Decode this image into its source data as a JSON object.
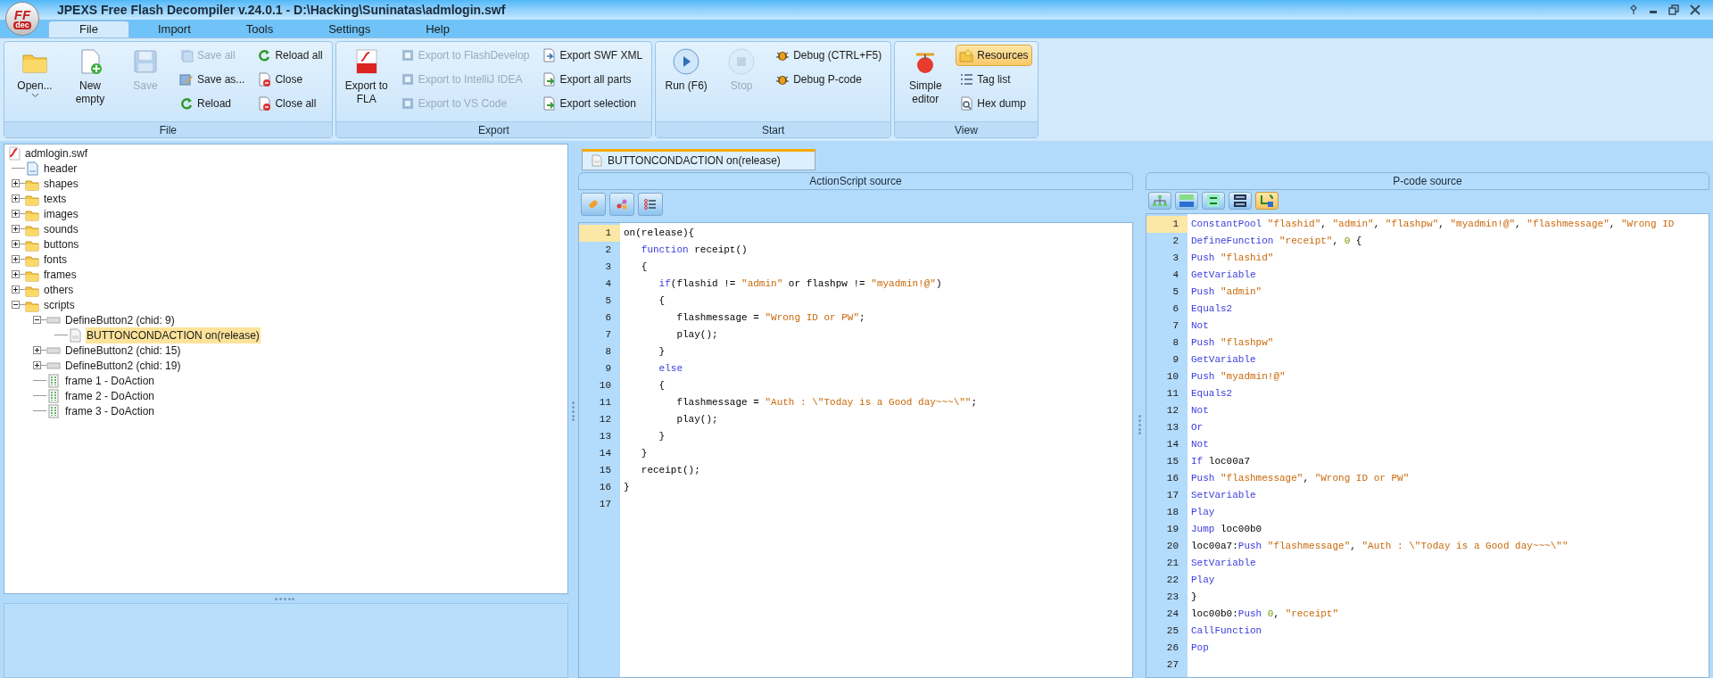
{
  "window": {
    "title": "JPEXS Free Flash Decompiler v.24.0.1 - D:\\Hacking\\Suninatas\\admlogin.swf",
    "logo": {
      "top": "FF",
      "bottom": "dec"
    }
  },
  "ribbon": {
    "tabs": [
      {
        "label": "File",
        "selected": true
      },
      {
        "label": "Import",
        "selected": false
      },
      {
        "label": "Tools",
        "selected": false
      },
      {
        "label": "Settings",
        "selected": false
      },
      {
        "label": "Help",
        "selected": false
      }
    ],
    "groups": [
      {
        "label": "File",
        "items": [
          {
            "kind": "large",
            "label": "Open...",
            "dropdown": true,
            "disabled": false
          },
          {
            "kind": "large",
            "label": "New empty",
            "disabled": false
          },
          {
            "kind": "large",
            "label": "Save",
            "disabled": true
          },
          {
            "kind": "column",
            "items": [
              {
                "label": "Save all",
                "disabled": true,
                "selected": false
              },
              {
                "label": "Save as...",
                "disabled": false,
                "selected": false
              },
              {
                "label": "Reload",
                "disabled": false,
                "selected": false
              }
            ]
          },
          {
            "kind": "column",
            "items": [
              {
                "label": "Reload all",
                "disabled": false,
                "selected": false
              },
              {
                "label": "Close",
                "disabled": false,
                "selected": false
              },
              {
                "label": "Close all",
                "disabled": false,
                "selected": false
              }
            ]
          }
        ]
      },
      {
        "label": "Export",
        "items": [
          {
            "kind": "large",
            "label": "Export to FLA",
            "disabled": false
          },
          {
            "kind": "column",
            "items": [
              {
                "label": "Export to FlashDevelop",
                "disabled": true,
                "selected": false
              },
              {
                "label": "Export to IntelliJ IDEA",
                "disabled": true,
                "selected": false
              },
              {
                "label": "Export to VS Code",
                "disabled": true,
                "selected": false
              }
            ]
          },
          {
            "kind": "column",
            "items": [
              {
                "label": "Export SWF XML",
                "disabled": false,
                "selected": false
              },
              {
                "label": "Export all parts",
                "disabled": false,
                "selected": false
              },
              {
                "label": "Export selection",
                "disabled": false,
                "selected": false
              }
            ]
          }
        ]
      },
      {
        "label": "Start",
        "items": [
          {
            "kind": "large",
            "label": "Run (F6)",
            "disabled": false
          },
          {
            "kind": "large",
            "label": "Stop",
            "disabled": true
          },
          {
            "kind": "column",
            "items": [
              {
                "label": "Debug (CTRL+F5)",
                "disabled": false,
                "selected": false
              },
              {
                "label": "Debug P-code",
                "disabled": false,
                "selected": false
              }
            ]
          }
        ]
      },
      {
        "label": "View",
        "items": [
          {
            "kind": "large",
            "label": "Simple editor",
            "disabled": false
          },
          {
            "kind": "column",
            "items": [
              {
                "label": "Resources",
                "disabled": false,
                "selected": true
              },
              {
                "label": "Tag list",
                "disabled": false,
                "selected": false
              },
              {
                "label": "Hex dump",
                "disabled": false,
                "selected": false
              }
            ]
          }
        ]
      }
    ]
  },
  "tree": [
    {
      "label": "admlogin.swf",
      "kind": "swf",
      "selected": false,
      "children": [
        {
          "label": "header",
          "kind": "header",
          "selected": false
        },
        {
          "label": "shapes",
          "kind": "folder",
          "selected": false,
          "expanded": false
        },
        {
          "label": "texts",
          "kind": "folder",
          "selected": false,
          "expanded": false
        },
        {
          "label": "images",
          "kind": "folder",
          "selected": false,
          "expanded": false
        },
        {
          "label": "sounds",
          "kind": "folder",
          "selected": false,
          "expanded": false
        },
        {
          "label": "buttons",
          "kind": "folder",
          "selected": false,
          "expanded": false
        },
        {
          "label": "fonts",
          "kind": "folder",
          "selected": false,
          "expanded": false
        },
        {
          "label": "frames",
          "kind": "folder",
          "selected": false,
          "expanded": false
        },
        {
          "label": "others",
          "kind": "folder",
          "selected": false,
          "expanded": false
        },
        {
          "label": "scripts",
          "kind": "folder",
          "selected": false,
          "expanded": true,
          "children": [
            {
              "label": "DefineButton2 (chid: 9)",
              "kind": "button",
              "selected": false,
              "expanded": true,
              "children": [
                {
                  "label": "BUTTONCONDACTION on(release)",
                  "kind": "script",
                  "selected": true
                }
              ]
            },
            {
              "label": "DefineButton2 (chid: 15)",
              "kind": "button",
              "selected": false,
              "expanded": false
            },
            {
              "label": "DefineButton2 (chid: 19)",
              "kind": "button",
              "selected": false,
              "expanded": false
            },
            {
              "label": "frame 1 - DoAction",
              "kind": "frame",
              "selected": false
            },
            {
              "label": "frame 2 - DoAction",
              "kind": "frame",
              "selected": false
            },
            {
              "label": "frame 3 - DoAction",
              "kind": "frame",
              "selected": false
            }
          ]
        }
      ]
    }
  ],
  "editor_tabs": [
    {
      "label": "BUTTONCONDACTION on(release)",
      "selected": true
    }
  ],
  "actionscript": {
    "title": "ActionScript source",
    "toolbar": [
      {
        "selected": false
      },
      {
        "selected": false
      },
      {
        "selected": false
      }
    ],
    "lines": [
      {
        "number": "1",
        "selected": true,
        "tokens": [
          {
            "kind": "plain",
            "text": "on(release){"
          }
        ]
      },
      {
        "number": "2",
        "selected": false,
        "tokens": [
          {
            "kind": "keyword",
            "text": "   function"
          },
          {
            "kind": "plain",
            "text": " receipt()"
          }
        ]
      },
      {
        "number": "3",
        "selected": false,
        "tokens": [
          {
            "kind": "plain",
            "text": "   {"
          }
        ]
      },
      {
        "number": "4",
        "selected": false,
        "tokens": [
          {
            "kind": "keyword",
            "text": "      if"
          },
          {
            "kind": "plain",
            "text": "(flashid != "
          },
          {
            "kind": "string",
            "text": "\"admin\""
          },
          {
            "kind": "plain",
            "text": " or flashpw != "
          },
          {
            "kind": "string",
            "text": "\"myadmin!@\""
          },
          {
            "kind": "plain",
            "text": ")"
          }
        ]
      },
      {
        "number": "5",
        "selected": false,
        "tokens": [
          {
            "kind": "plain",
            "text": "      {"
          }
        ]
      },
      {
        "number": "6",
        "selected": false,
        "tokens": [
          {
            "kind": "plain",
            "text": "         flashmessage = "
          },
          {
            "kind": "string",
            "text": "\"Wrong ID or PW\""
          },
          {
            "kind": "plain",
            "text": ";"
          }
        ]
      },
      {
        "number": "7",
        "selected": false,
        "tokens": [
          {
            "kind": "plain",
            "text": "         play();"
          }
        ]
      },
      {
        "number": "8",
        "selected": false,
        "tokens": [
          {
            "kind": "plain",
            "text": "      }"
          }
        ]
      },
      {
        "number": "9",
        "selected": false,
        "tokens": [
          {
            "kind": "keyword",
            "text": "      else"
          }
        ]
      },
      {
        "number": "10",
        "selected": false,
        "tokens": [
          {
            "kind": "plain",
            "text": "      {"
          }
        ]
      },
      {
        "number": "11",
        "selected": false,
        "tokens": [
          {
            "kind": "plain",
            "text": "         flashmessage = "
          },
          {
            "kind": "string",
            "text": "\"Auth : \\\"Today is a Good day~~~\\\"\""
          },
          {
            "kind": "plain",
            "text": ";"
          }
        ]
      },
      {
        "number": "12",
        "selected": false,
        "tokens": [
          {
            "kind": "plain",
            "text": "         play();"
          }
        ]
      },
      {
        "number": "13",
        "selected": false,
        "tokens": [
          {
            "kind": "plain",
            "text": "      }"
          }
        ]
      },
      {
        "number": "14",
        "selected": false,
        "tokens": [
          {
            "kind": "plain",
            "text": "   }"
          }
        ]
      },
      {
        "number": "15",
        "selected": false,
        "tokens": [
          {
            "kind": "plain",
            "text": "   receipt();"
          }
        ]
      },
      {
        "number": "16",
        "selected": false,
        "tokens": [
          {
            "kind": "plain",
            "text": "}"
          }
        ]
      },
      {
        "number": "17",
        "selected": false
      }
    ]
  },
  "pcode": {
    "title": "P-code source",
    "toolbar": [
      {
        "selected": false
      },
      {
        "selected": false
      },
      {
        "selected": false
      },
      {
        "selected": false
      },
      {
        "selected": true
      }
    ],
    "lines": [
      {
        "number": "1",
        "selected": true,
        "tokens": [
          {
            "kind": "keyword",
            "text": "ConstantPool"
          },
          {
            "kind": "string",
            "text": " \"flashid\""
          },
          {
            "kind": "plain",
            "text": ","
          },
          {
            "kind": "string",
            "text": " \"admin\""
          },
          {
            "kind": "plain",
            "text": ","
          },
          {
            "kind": "string",
            "text": " \"flashpw\""
          },
          {
            "kind": "plain",
            "text": ","
          },
          {
            "kind": "string",
            "text": " \"myadmin!@\""
          },
          {
            "kind": "plain",
            "text": ","
          },
          {
            "kind": "string",
            "text": " \"flashmessage\""
          },
          {
            "kind": "plain",
            "text": ","
          },
          {
            "kind": "string",
            "text": " \"Wrong ID"
          }
        ]
      },
      {
        "number": "2",
        "selected": false,
        "tokens": [
          {
            "kind": "keyword",
            "text": "DefineFunction"
          },
          {
            "kind": "string",
            "text": " \"receipt\""
          },
          {
            "kind": "plain",
            "text": ","
          },
          {
            "kind": "number",
            "text": " 0"
          },
          {
            "kind": "plain",
            "text": " {"
          }
        ]
      },
      {
        "number": "3",
        "selected": false,
        "tokens": [
          {
            "kind": "keyword",
            "text": "Push"
          },
          {
            "kind": "string",
            "text": " \"flashid\""
          }
        ]
      },
      {
        "number": "4",
        "selected": false,
        "tokens": [
          {
            "kind": "keyword",
            "text": "GetVariable"
          }
        ]
      },
      {
        "number": "5",
        "selected": false,
        "tokens": [
          {
            "kind": "keyword",
            "text": "Push"
          },
          {
            "kind": "string",
            "text": " \"admin\""
          }
        ]
      },
      {
        "number": "6",
        "selected": false,
        "tokens": [
          {
            "kind": "keyword",
            "text": "Equals2"
          }
        ]
      },
      {
        "number": "7",
        "selected": false,
        "tokens": [
          {
            "kind": "keyword",
            "text": "Not"
          }
        ]
      },
      {
        "number": "8",
        "selected": false,
        "tokens": [
          {
            "kind": "keyword",
            "text": "Push"
          },
          {
            "kind": "string",
            "text": " \"flashpw\""
          }
        ]
      },
      {
        "number": "9",
        "selected": false,
        "tokens": [
          {
            "kind": "keyword",
            "text": "GetVariable"
          }
        ]
      },
      {
        "number": "10",
        "selected": false,
        "tokens": [
          {
            "kind": "keyword",
            "text": "Push"
          },
          {
            "kind": "string",
            "text": " \"myadmin!@\""
          }
        ]
      },
      {
        "number": "11",
        "selected": false,
        "tokens": [
          {
            "kind": "keyword",
            "text": "Equals2"
          }
        ]
      },
      {
        "number": "12",
        "selected": false,
        "tokens": [
          {
            "kind": "keyword",
            "text": "Not"
          }
        ]
      },
      {
        "number": "13",
        "selected": false,
        "tokens": [
          {
            "kind": "keyword",
            "text": "Or"
          }
        ]
      },
      {
        "number": "14",
        "selected": false,
        "tokens": [
          {
            "kind": "keyword",
            "text": "Not"
          }
        ]
      },
      {
        "number": "15",
        "selected": false,
        "tokens": [
          {
            "kind": "keyword",
            "text": "If"
          },
          {
            "kind": "plain",
            "text": " loc00a7"
          }
        ]
      },
      {
        "number": "16",
        "selected": false,
        "tokens": [
          {
            "kind": "keyword",
            "text": "Push"
          },
          {
            "kind": "string",
            "text": " \"flashmessage\""
          },
          {
            "kind": "plain",
            "text": ","
          },
          {
            "kind": "string",
            "text": " \"Wrong ID or PW\""
          }
        ]
      },
      {
        "number": "17",
        "selected": false,
        "tokens": [
          {
            "kind": "keyword",
            "text": "SetVariable"
          }
        ]
      },
      {
        "number": "18",
        "selected": false,
        "tokens": [
          {
            "kind": "keyword",
            "text": "Play"
          }
        ]
      },
      {
        "number": "19",
        "selected": false,
        "tokens": [
          {
            "kind": "keyword",
            "text": "Jump"
          },
          {
            "kind": "plain",
            "text": " loc00b0"
          }
        ]
      },
      {
        "number": "20",
        "selected": false,
        "tokens": [
          {
            "kind": "plain",
            "text": "loc00a7:"
          },
          {
            "kind": "keyword",
            "text": "Push"
          },
          {
            "kind": "string",
            "text": " \"flashmessage\""
          },
          {
            "kind": "plain",
            "text": ","
          },
          {
            "kind": "string",
            "text": " \"Auth : \\\"Today is a Good day~~~\\\"\""
          }
        ]
      },
      {
        "number": "21",
        "selected": false,
        "tokens": [
          {
            "kind": "keyword",
            "text": "SetVariable"
          }
        ]
      },
      {
        "number": "22",
        "selected": false,
        "tokens": [
          {
            "kind": "keyword",
            "text": "Play"
          }
        ]
      },
      {
        "number": "23",
        "selected": false,
        "tokens": [
          {
            "kind": "plain",
            "text": "}"
          }
        ]
      },
      {
        "number": "24",
        "selected": false,
        "tokens": [
          {
            "kind": "plain",
            "text": "loc00b0:"
          },
          {
            "kind": "keyword",
            "text": "Push"
          },
          {
            "kind": "number",
            "text": " 0"
          },
          {
            "kind": "plain",
            "text": ","
          },
          {
            "kind": "string",
            "text": " \"receipt\""
          }
        ]
      },
      {
        "number": "25",
        "selected": false,
        "tokens": [
          {
            "kind": "keyword",
            "text": "CallFunction"
          }
        ]
      },
      {
        "number": "26",
        "selected": false,
        "tokens": [
          {
            "kind": "keyword",
            "text": "Pop"
          }
        ]
      },
      {
        "number": "27",
        "selected": false
      }
    ]
  }
}
